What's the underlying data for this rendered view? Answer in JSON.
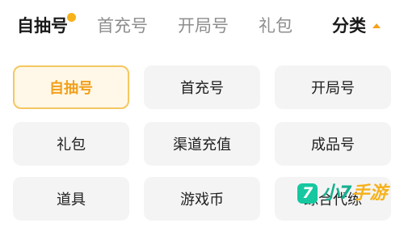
{
  "tabs": [
    {
      "label": "自抽号",
      "active": true
    },
    {
      "label": "首充号",
      "active": false
    },
    {
      "label": "开局号",
      "active": false
    },
    {
      "label": "礼包",
      "active": false
    }
  ],
  "category": {
    "label": "分类",
    "icon": "caret-up-icon"
  },
  "grid": [
    {
      "label": "自抽号",
      "selected": true
    },
    {
      "label": "首充号",
      "selected": false
    },
    {
      "label": "开局号",
      "selected": false
    },
    {
      "label": "礼包",
      "selected": false
    },
    {
      "label": "渠道充值",
      "selected": false
    },
    {
      "label": "成品号",
      "selected": false
    },
    {
      "label": "道具",
      "selected": false
    },
    {
      "label": "游戏币",
      "selected": false
    },
    {
      "label": "综合代练",
      "selected": false
    }
  ],
  "watermark": {
    "icon_char": "7",
    "text_a": "小7",
    "text_b": "手游"
  },
  "colors": {
    "accent": "#f29f1a",
    "selected_bg": "#fff8e8",
    "cell_bg": "#f4f4f4",
    "watermark_green": "#16b08f"
  }
}
